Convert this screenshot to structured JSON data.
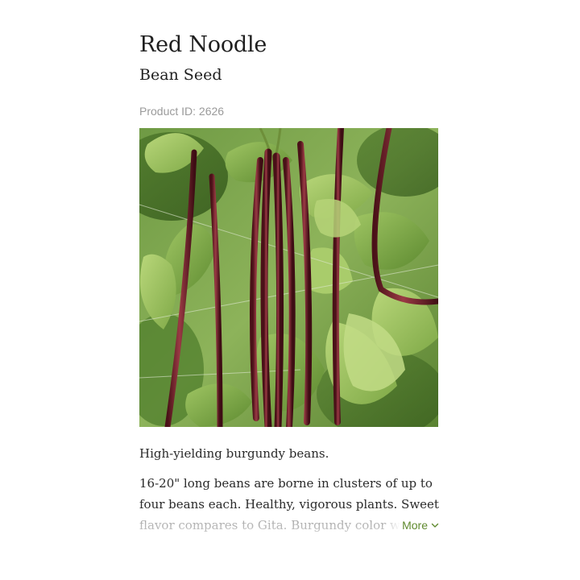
{
  "product": {
    "title": "Red Noodle",
    "subtitle": "Bean Seed",
    "product_id_text": "Product ID: 2626",
    "image_alt": "Red Noodle bean pods hanging among green leaves",
    "tagline": "High-yielding burgundy beans.",
    "description": "16-20\" long beans are borne in clusters of up to four beans each. Healthy, vigorous plants. Sweet flavor compares to Gita. Burgundy color wi",
    "more_label": "More"
  },
  "colors": {
    "accent": "#5f8a2e",
    "muted_text": "#9a9a9a",
    "body_text": "#2a2a2a"
  },
  "icons": {
    "more": "chevron-down-icon"
  }
}
